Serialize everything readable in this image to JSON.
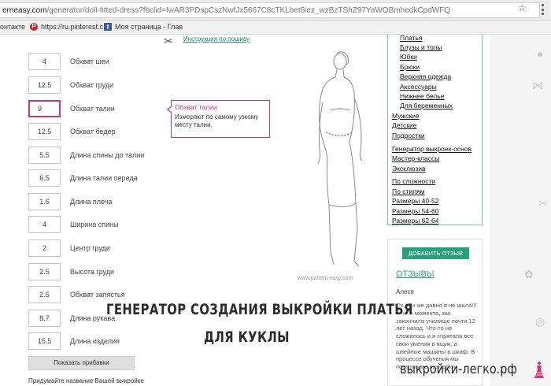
{
  "browser": {
    "url_prefix": "erneasy.com",
    "url_rest": "/generator/doll-fitted-dress?fbclid=IwAR3PDspCszNwfJx5667C8cTKLbet6iez_wzBzTShZ97YaWOBmhedkCpdWFQ",
    "star_icon": "star-icon",
    "bookmarks": [
      {
        "label": "онтакте",
        "icon": ""
      },
      {
        "label": "https://ru.pinterest.c",
        "icon": "pinterest-icon"
      },
      {
        "label": "Моя страница - Глав",
        "icon": "facebook-icon"
      }
    ]
  },
  "page": {
    "instructions_link": "Инструкция по пошиву",
    "fields": [
      {
        "value": "4",
        "label": "Обхват шеи"
      },
      {
        "value": "12.5",
        "label": "Обхват груди"
      },
      {
        "value": "9",
        "label": "Обхват талии",
        "active": true
      },
      {
        "value": "12.5",
        "label": "Обхват бедер"
      },
      {
        "value": "5.5",
        "label": "Длина спины до талии"
      },
      {
        "value": "6.5",
        "label": "Длина талии переда"
      },
      {
        "value": "1.6",
        "label": "Длина плеча"
      },
      {
        "value": "4",
        "label": "Ширина спины"
      },
      {
        "value": "2",
        "label": "Центр груди"
      },
      {
        "value": "2.5",
        "label": "Высота груди"
      },
      {
        "value": "2.5",
        "label": "Обхват запястья"
      },
      {
        "value": "8.7",
        "label": "Длина рукава"
      },
      {
        "value": "15.5",
        "label": "Длина изделия"
      }
    ],
    "tooltip": {
      "title": "Обхват талии",
      "body": "Измеряют по самому узкому месту талии."
    },
    "show_allowances_button": "Показать прибавки",
    "name_hint": "Придумайте название Вашей выкройке",
    "figure_watermark": "www.pattern-easy.com"
  },
  "sidebar": {
    "menu_items": [
      "Платья",
      "Блузы и топы",
      "Юбки",
      "Брюки",
      "Верхняя одежда",
      "Аксессуары",
      "Нижнее белье",
      "Для беременных",
      "Мужские",
      "Детские",
      "Подростки",
      "Генератор выкроек-основ",
      "Мастер-классы",
      "Эксклюзив",
      "По сложности",
      "По стилям",
      "Размеры 40-52",
      "Размеры 54-60",
      "Размеры 62-64"
    ],
    "add_review_button": "ДОБАВИТЬ ОТЗЫВ",
    "reviews_title": "ОТЗЫВЫ",
    "review_author": "Алеся",
    "review_text": "Ох, как же давно я не шила!!! С того момента, как закончила училище почти 12 лет назад. Что-то не сложилось и я спрятала все свои умения в ящик, а швейные машины в шкаф. В процессе обучения мы построение выкройки-"
  },
  "overlay": {
    "line1": "ГЕНЕРАТОР СОЗДАНИЯ ВЫКРОЙКИ ПЛАТЬЯ",
    "line2": "ДЛЯ КУКЛЫ",
    "site": "выкройки-легко.рф"
  },
  "colors": {
    "accent_green": "#2a9f7d",
    "accent_pink": "#c5397b"
  }
}
